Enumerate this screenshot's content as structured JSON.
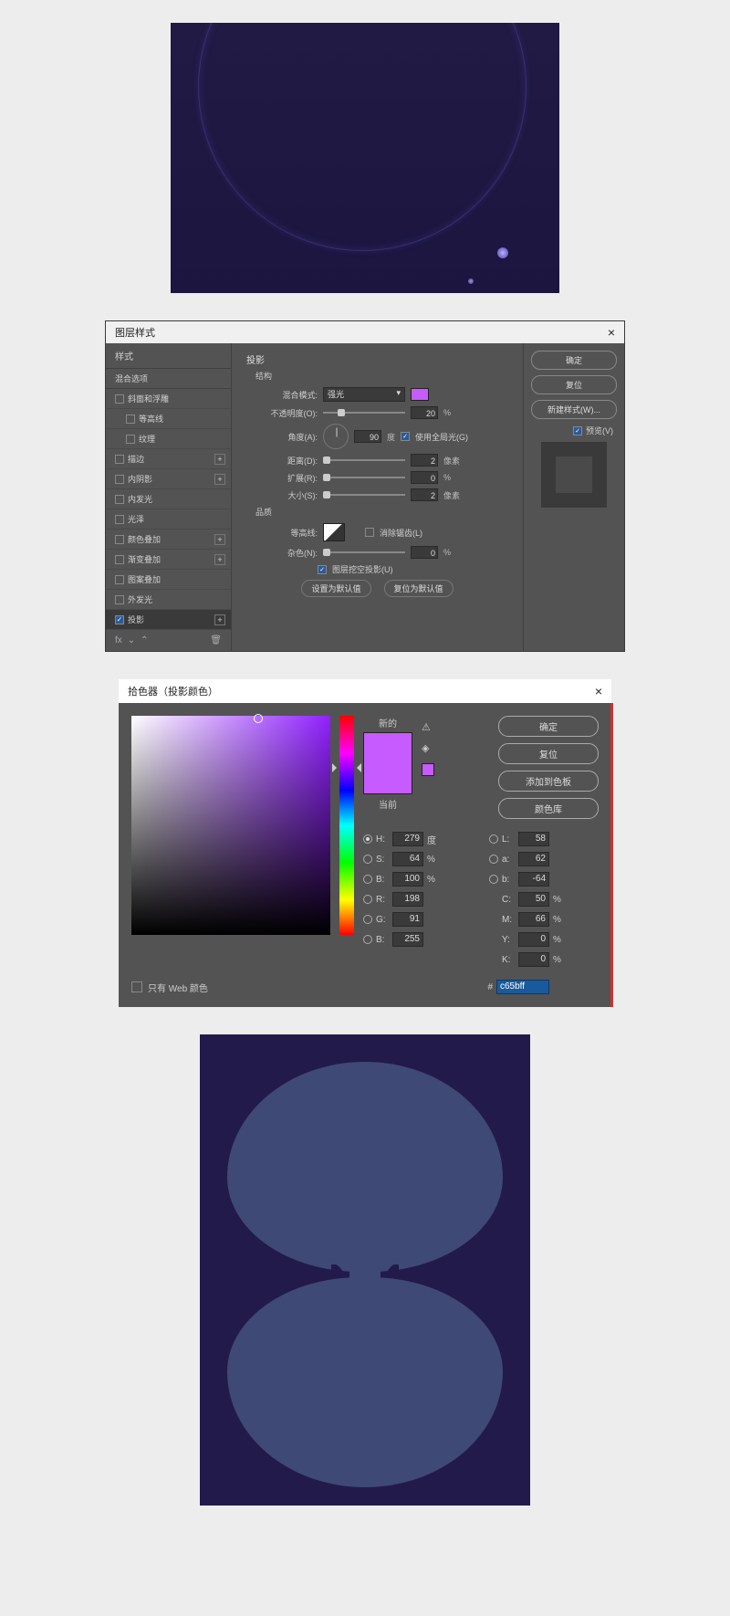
{
  "layerStyle": {
    "title": "图层样式",
    "col1": {
      "styles_label": "样式",
      "blend_label": "混合选项",
      "items": [
        {
          "label": "斜面和浮雕",
          "checked": false,
          "plus": false
        },
        {
          "label": "等高线",
          "checked": false,
          "plus": false,
          "sub": true
        },
        {
          "label": "纹理",
          "checked": false,
          "plus": false,
          "sub": true
        },
        {
          "label": "描边",
          "checked": false,
          "plus": true
        },
        {
          "label": "内阴影",
          "checked": false,
          "plus": true
        },
        {
          "label": "内发光",
          "checked": false,
          "plus": false
        },
        {
          "label": "光泽",
          "checked": false,
          "plus": false
        },
        {
          "label": "颜色叠加",
          "checked": false,
          "plus": true
        },
        {
          "label": "渐变叠加",
          "checked": false,
          "plus": true
        },
        {
          "label": "图案叠加",
          "checked": false,
          "plus": false
        },
        {
          "label": "外发光",
          "checked": false,
          "plus": false
        },
        {
          "label": "投影",
          "checked": true,
          "plus": true,
          "active": true
        }
      ]
    },
    "section_title": "投影",
    "structure_label": "结构",
    "blend_mode": {
      "label": "混合模式:",
      "value": "强光",
      "color": "#c65bff"
    },
    "opacity": {
      "label": "不透明度(O):",
      "value": "20",
      "unit": "%"
    },
    "angle": {
      "label": "角度(A):",
      "value": "90",
      "unit": "度",
      "global_label": "使用全局光(G)"
    },
    "distance": {
      "label": "距离(D):",
      "value": "2",
      "unit": "像素"
    },
    "spread": {
      "label": "扩展(R):",
      "value": "0",
      "unit": "%"
    },
    "size": {
      "label": "大小(S):",
      "value": "2",
      "unit": "像素"
    },
    "quality_label": "品质",
    "contour": {
      "label": "等高线:",
      "anti_label": "消除锯齿(L)"
    },
    "noise": {
      "label": "杂色(N):",
      "value": "0",
      "unit": "%"
    },
    "knockout_label": "图层挖空投影(U)",
    "make_default": "设置为默认值",
    "reset_default": "复位为默认值",
    "ok": "确定",
    "cancel": "复位",
    "new_style": "新建样式(W)...",
    "preview": "预览(V)"
  },
  "picker": {
    "title": "拾色器（投影颜色）",
    "new_label": "新的",
    "current_label": "当前",
    "ok": "确定",
    "cancel": "复位",
    "add_swatch": "添加到色板",
    "color_lib": "颜色库",
    "H": {
      "label": "H:",
      "value": "279",
      "unit": "度"
    },
    "S": {
      "label": "S:",
      "value": "64",
      "unit": "%"
    },
    "Bv": {
      "label": "B:",
      "value": "100",
      "unit": "%"
    },
    "R": {
      "label": "R:",
      "value": "198"
    },
    "G": {
      "label": "G:",
      "value": "91"
    },
    "Bc": {
      "label": "B:",
      "value": "255"
    },
    "L": {
      "label": "L:",
      "value": "58"
    },
    "a": {
      "label": "a:",
      "value": "62"
    },
    "b": {
      "label": "b:",
      "value": "-64"
    },
    "C": {
      "label": "C:",
      "value": "50",
      "unit": "%"
    },
    "M": {
      "label": "M:",
      "value": "66",
      "unit": "%"
    },
    "Y": {
      "label": "Y:",
      "value": "0",
      "unit": "%"
    },
    "K": {
      "label": "K:",
      "value": "0",
      "unit": "%"
    },
    "web_only": "只有 Web 颜色",
    "hex_label": "#",
    "hex": "c65bff"
  }
}
